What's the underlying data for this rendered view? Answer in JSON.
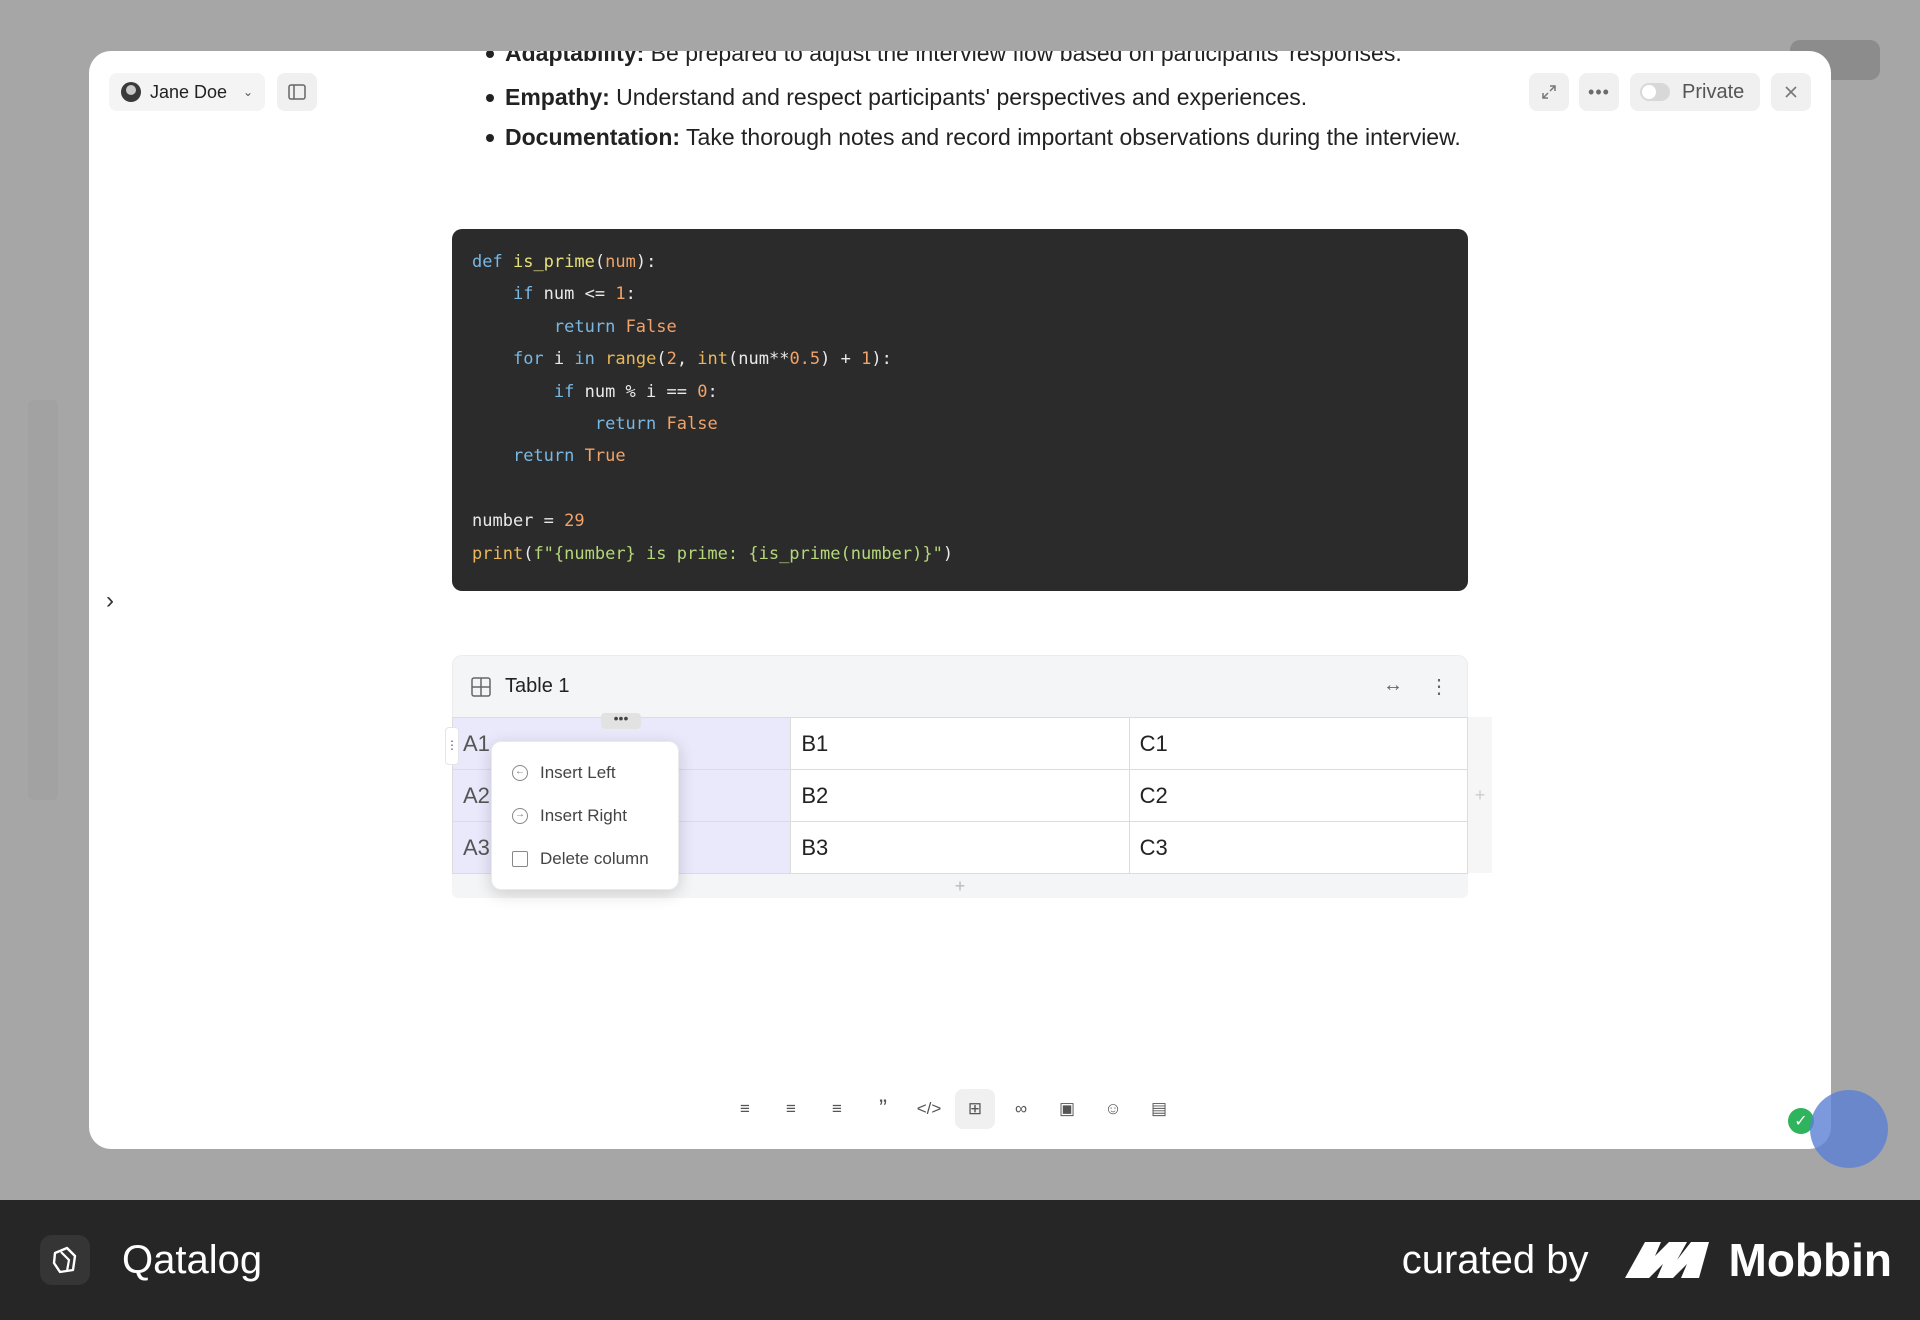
{
  "header": {
    "user_name": "Jane Doe",
    "visibility_label": "Private"
  },
  "bullets": [
    {
      "term": "Adaptability:",
      "text": " Be prepared to adjust the interview flow based on participants' responses."
    },
    {
      "term": "Empathy:",
      "text": " Understand and respect participants' perspectives and experiences."
    },
    {
      "term": "Documentation:",
      "text": " Take thorough notes and record important observations during the interview."
    }
  ],
  "code_lines": [
    "def is_prime(num):",
    "    if num <= 1:",
    "        return False",
    "    for i in range(2, int(num**0.5) + 1):",
    "        if num % i == 0:",
    "            return False",
    "    return True",
    "",
    "number = 29",
    "print(f\"{number} is prime: {is_prime(number)}\")"
  ],
  "table": {
    "title": "Table 1",
    "rows": [
      [
        "A1",
        "B1",
        "C1"
      ],
      [
        "A2",
        "B2",
        "C2"
      ],
      [
        "A3",
        "B3",
        "C3"
      ]
    ]
  },
  "context_menu": {
    "items": [
      "Insert Left",
      "Insert Right",
      "Delete column"
    ]
  },
  "footer": {
    "brand": "Qatalog",
    "curated_by": "curated by",
    "curator": "Mobbin"
  }
}
